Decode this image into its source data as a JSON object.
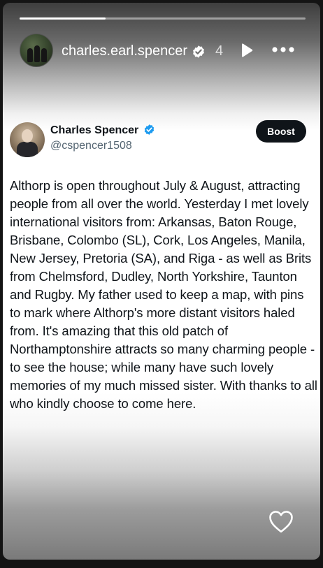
{
  "story": {
    "progress": 0.3,
    "username": "charles.earl.spencer",
    "time": "4",
    "icons": [
      "verified-badge-icon",
      "play-icon",
      "more-icon",
      "heart-icon"
    ]
  },
  "tweet": {
    "display_name": "Charles Spencer",
    "handle": "@cspencer1508",
    "boost_label": "Boost",
    "text": "Althorp is open throughout July & August, attracting people from all over the world. Yesterday I met lovely international visitors from: Arkansas, Baton Rouge, Brisbane, Colombo (SL), Cork, Los Angeles, Manila, New Jersey, Pretoria (SA), and Riga - as well as Brits from Chelmsford, Dudley, North Yorkshire, Taunton and Rugby. My father used to keep a map, with pins to mark where Althorp's more distant visitors haled from. It's amazing that this old patch of Northamptonshire attracts so many charming people - to see the house; while many have such lovely memories of my much missed sister. With thanks to all who kindly choose to come here."
  },
  "colors": {
    "verified_blue": "#1d9bf0",
    "boost_bg": "#0f1419",
    "text_primary": "#0f1419",
    "text_secondary": "#536471"
  }
}
